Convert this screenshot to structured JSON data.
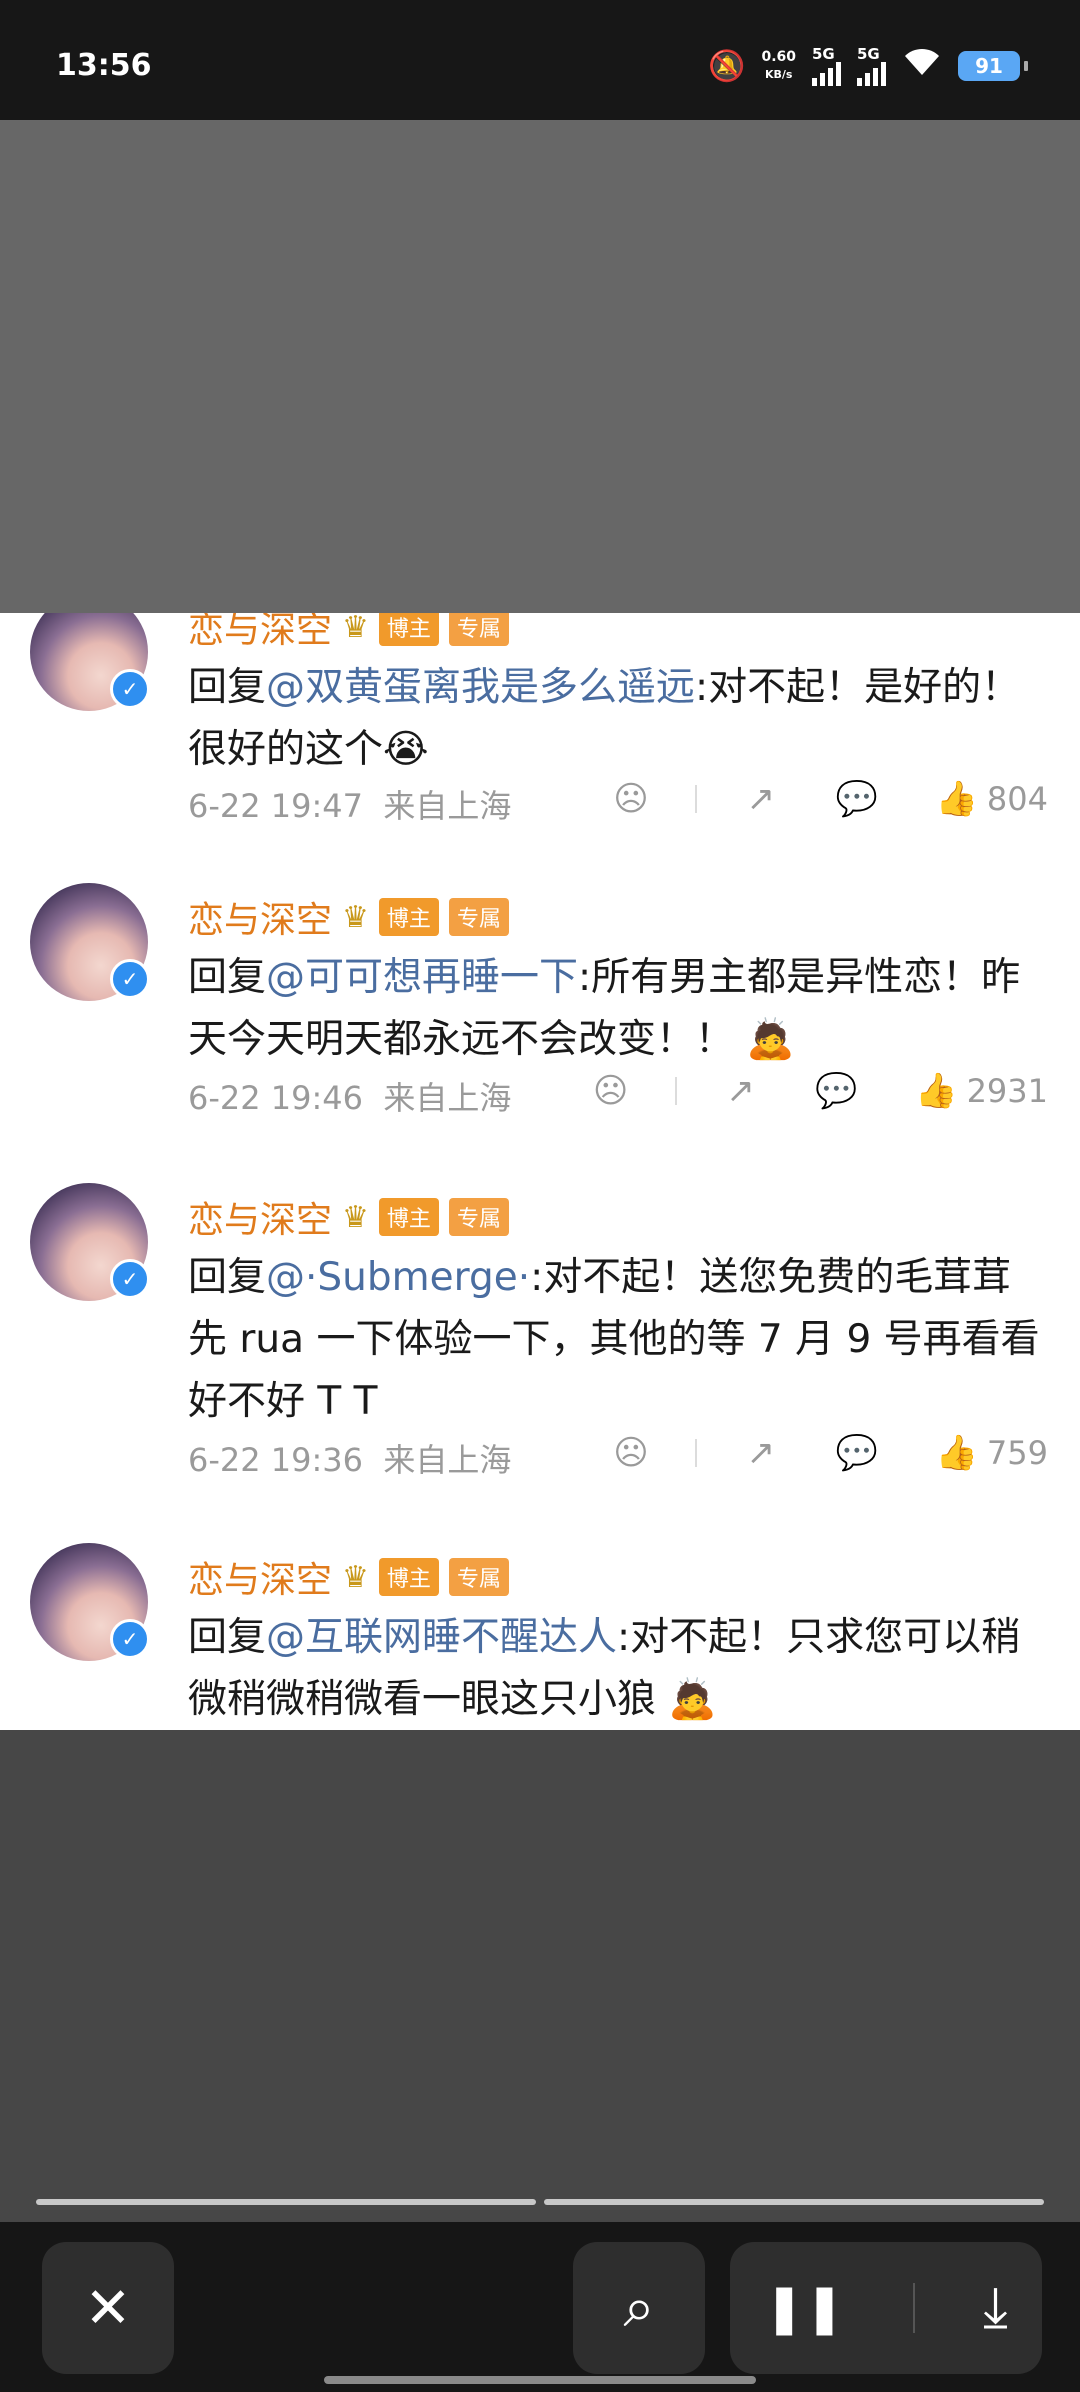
{
  "status_bar": {
    "time": "13:56",
    "speed_value": "0.60",
    "speed_unit": "KB/s",
    "signal1": "5G",
    "signal2": "5G",
    "battery": "91"
  },
  "comments": [
    {
      "username": "恋与深空",
      "badge_blogger": "博主",
      "badge_exclusive": "专属",
      "reply_prefix": "回复",
      "mention": "@双黄蛋离我是多么遥远",
      "body": ":对不起！是好的！很好的这个😭",
      "date": "6-22 19:47",
      "location": "来自上海",
      "likes": "804"
    },
    {
      "username": "恋与深空",
      "badge_blogger": "博主",
      "badge_exclusive": "专属",
      "reply_prefix": "回复",
      "mention": "@可可想再睡一下",
      "body": ":所有男主都是异性恋！昨天今天明天都永远不会改变！！ 🙇",
      "date": "6-22 19:46",
      "location": "来自上海",
      "likes": "2931"
    },
    {
      "username": "恋与深空",
      "badge_blogger": "博主",
      "badge_exclusive": "专属",
      "reply_prefix": "回复",
      "mention": "@·Submerge·",
      "body": ":对不起！送您免费的毛茸茸先 rua 一下体验一下，其他的等 7 月 9 号再看看好不好 T T",
      "date": "6-22 19:36",
      "location": "来自上海",
      "likes": "759"
    },
    {
      "username": "恋与深空",
      "badge_blogger": "博主",
      "badge_exclusive": "专属",
      "reply_prefix": "回复",
      "mention": "@互联网睡不醒达人",
      "body": ":对不起！只求您可以稍微稍微稍微看一眼这只小狼 🙇"
    }
  ],
  "toolbar": {
    "close_icon": "✕",
    "scan_icon": "⌕",
    "pause_icon": "❚❚",
    "download_icon": "⤓"
  }
}
